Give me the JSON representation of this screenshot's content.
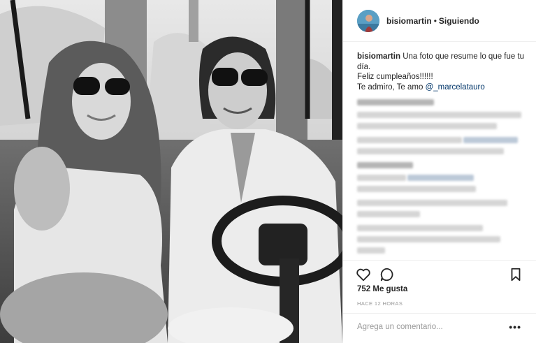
{
  "post": {
    "username": "bisiomartin",
    "separator": "•",
    "follow_status": "Siguiendo",
    "caption_line1": "Una foto que resume lo que fue tu día.",
    "caption_line2": "Feliz cumpleaños!!!!!!",
    "caption_line3_prefix": "Te admiro, Te amo",
    "mention": "@_marcelatauro",
    "likes": "752 Me gusta",
    "time_ago": "HACE 12 HORAS",
    "comment_placeholder": "Agrega un comentario...",
    "more_options": "•••"
  },
  "icons": {
    "like": "heart-icon",
    "comment": "comment-icon",
    "save": "bookmark-icon",
    "more": "more-options-icon"
  },
  "colors": {
    "mention": "#003569",
    "muted": "#999999",
    "text": "#262626",
    "avatar_bg": "#5a9fc4"
  }
}
